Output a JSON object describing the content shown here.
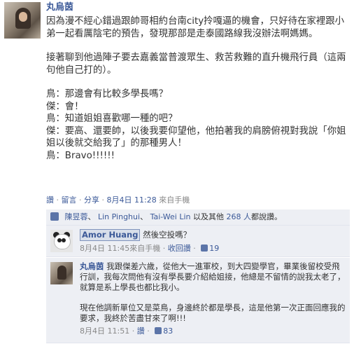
{
  "post": {
    "author": "丸烏茵",
    "paragraphs": [
      [
        "因為漫不經心錯過跟帥哥相約台南city拎嘎逼的機會，只好待在家裡跟小弟一起看厲陰宅的預告，發現那部是走泰國路線我沒辦法啊媽媽。"
      ],
      [
        "接著聊到他過陣子要去嘉義當普渡眾生、救苦救難的直升機飛行員（這兩句他自己打的）。"
      ],
      [
        "鳥：那邊會有比較多學長嗎？",
        "傑：會！",
        "鳥：知道姐姐喜歡哪一種的吧？",
        "傑：要高、還要帥，以後我要仰望他，他拍著我的肩膀俯視對我說「你姐姐以後就交給我了」的那種男人！",
        "鳥：Bravo!!!!!!"
      ]
    ],
    "actions": {
      "like": "讚",
      "comment": "留言",
      "share": "分享"
    },
    "timestamp": "8月4日 11:28",
    "via": "來自手機"
  },
  "likes": {
    "names": [
      "陳昱蓉",
      "Lin Pinghui",
      "Tai-Wei Lin"
    ],
    "separator": "、",
    "and_text": "以及其他",
    "others": "268 人",
    "suffix": "都說讚。"
  },
  "comments": [
    {
      "author": "Amor Huang",
      "text": [
        "然後空投嗎？"
      ],
      "timestamp": "8月4日 11:45",
      "via": "來自手機",
      "action": "收回讚",
      "like_count": "19"
    },
    {
      "author": "丸烏茵",
      "text": [
        "我跟傑差六歲，從他大一進軍校，到大四變學官，畢業後留校受飛行訓，我每次問他有沒有學長要介紹給姐接，他總是不留情的說我太老了，就算是系上學長也都比我小。",
        "現在他調新單位又是菜鳥，身邊終於都是學長，這是他第一次正面回應我的要求，我終於苦盡甘來了啊!!!"
      ],
      "timestamp": "8月4日 11:51",
      "action": "讚",
      "like_count": "83"
    }
  ]
}
